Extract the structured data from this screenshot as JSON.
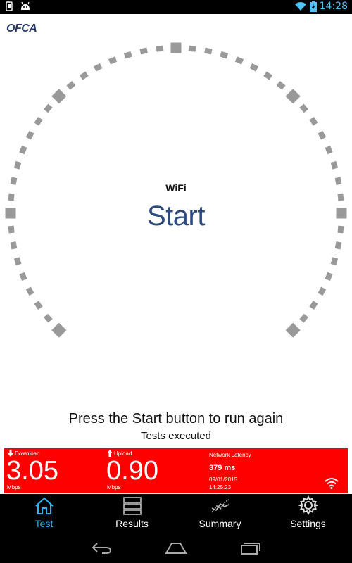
{
  "status_bar": {
    "time": "14:28"
  },
  "app": {
    "logo_text": "OFCA"
  },
  "gauge": {
    "network_type": "WiFi",
    "start_label": "Start"
  },
  "messages": {
    "main": "Press the Start button to run again",
    "sub": "Tests executed"
  },
  "results": {
    "download": {
      "label": "Download",
      "value": "3.05",
      "unit": "Mbps"
    },
    "upload": {
      "label": "Upload",
      "value": "0.90",
      "unit": "Mbps"
    },
    "latency": {
      "label": "Network Latency",
      "value": "379 ms",
      "date": "09/01/2015",
      "time": "14:25:23"
    },
    "connection_icon": "wifi-icon",
    "panel_color": "#ff0000"
  },
  "tabs": [
    {
      "label": "Test",
      "icon": "home-icon",
      "active": true
    },
    {
      "label": "Results",
      "icon": "list-icon",
      "active": false
    },
    {
      "label": "Summary",
      "icon": "chart-line-icon",
      "active": false
    },
    {
      "label": "Settings",
      "icon": "gear-icon",
      "active": false
    }
  ],
  "colors": {
    "accent": "#29b6f6",
    "start_text": "#2b4a82",
    "gauge_ticks": "#999999"
  }
}
